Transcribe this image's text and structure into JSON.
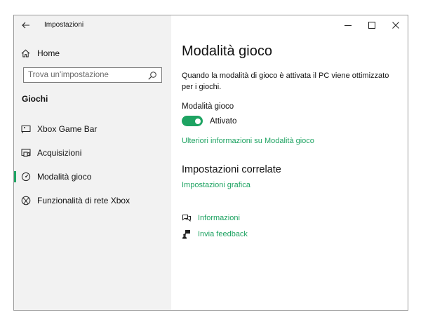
{
  "window": {
    "title": "Impostazioni"
  },
  "sidebar": {
    "home_label": "Home",
    "search_placeholder": "Trova un'impostazione",
    "section_title": "Giochi",
    "items": [
      {
        "label": "Xbox Game Bar",
        "icon": "xbox-game-bar-icon",
        "selected": false
      },
      {
        "label": "Acquisizioni",
        "icon": "captures-icon",
        "selected": false
      },
      {
        "label": "Modalità gioco",
        "icon": "game-mode-icon",
        "selected": true
      },
      {
        "label": "Funzionalità di rete Xbox",
        "icon": "xbox-logo-icon",
        "selected": false
      }
    ]
  },
  "main": {
    "title": "Modalità gioco",
    "description": "Quando la modalità di gioco è attivata il PC viene ottimizzato per i giochi.",
    "toggle_label": "Modalità gioco",
    "toggle_state": "Attivato",
    "toggle_on": true,
    "more_info_link": "Ulteriori informazioni su Modalità gioco",
    "related_title": "Impostazioni correlate",
    "graphics_link": "Impostazioni grafica",
    "help_links": [
      {
        "label": "Informazioni",
        "icon": "get-help-icon"
      },
      {
        "label": "Invia feedback",
        "icon": "feedback-icon"
      }
    ]
  },
  "colors": {
    "accent": "#1ea362",
    "sidebar_bg": "#f2f2f2",
    "text": "#111111"
  }
}
